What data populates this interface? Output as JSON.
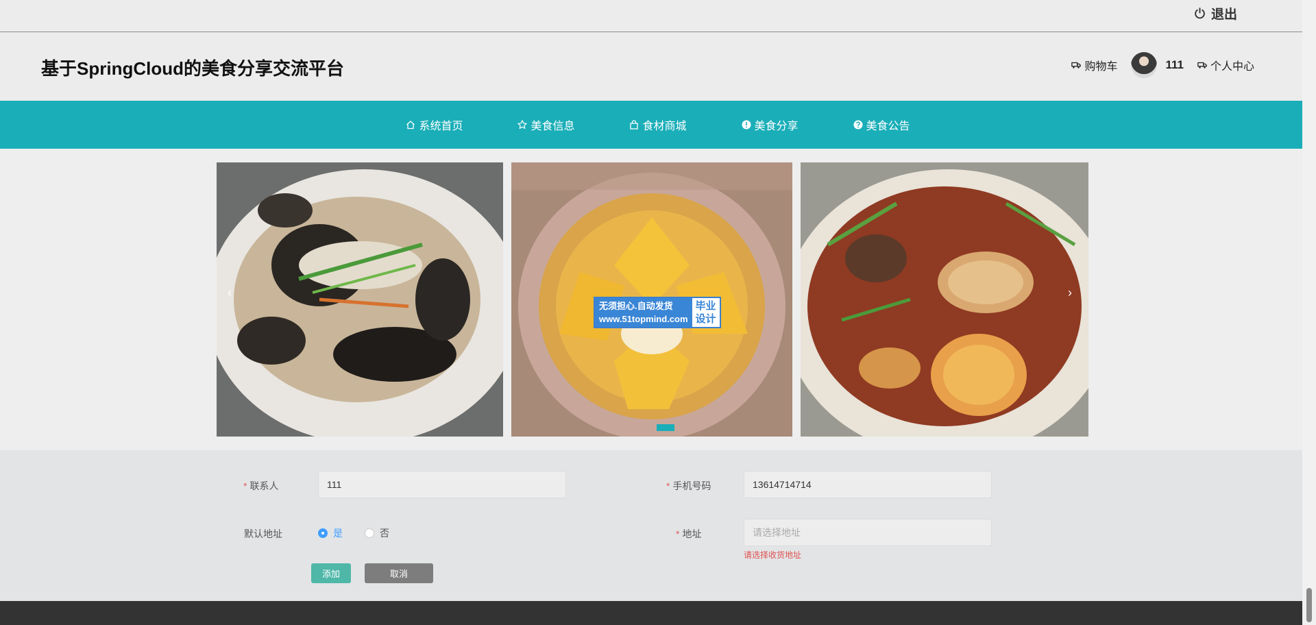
{
  "topbar": {
    "logout_label": "退出"
  },
  "header": {
    "site_title": "基于SpringCloud的美食分享交流平台",
    "cart_label": "购物车",
    "username": "111",
    "profile_label": "个人中心"
  },
  "nav": {
    "items": [
      {
        "label": "系统首页",
        "icon": "home-icon"
      },
      {
        "label": "美食信息",
        "icon": "star-icon"
      },
      {
        "label": "食材商城",
        "icon": "bag-icon"
      },
      {
        "label": "美食分享",
        "icon": "info-icon"
      },
      {
        "label": "美食公告",
        "icon": "question-icon"
      }
    ]
  },
  "banner": {
    "watermark_line1": "无须担心.自动发货",
    "watermark_line2": "www.51topmind.com",
    "watermark_badge1": "毕业",
    "watermark_badge2": "设计",
    "prev_label": "‹",
    "next_label": "›"
  },
  "form": {
    "contact_label": "联系人",
    "contact_value": "111",
    "phone_label": "手机号码",
    "phone_value": "13614714714",
    "default_label": "默认地址",
    "default_yes": "是",
    "default_no": "否",
    "default_selected": "是",
    "address_label": "地址",
    "address_placeholder": "请选择地址",
    "address_error": "请选择收货地址",
    "add_button": "添加",
    "cancel_button": "取消"
  },
  "colors": {
    "nav_bg": "#1aaeb8",
    "add_button": "#4fb7a8",
    "cancel_button": "#7d7d7d",
    "error": "#e05050",
    "footer": "#333333"
  }
}
